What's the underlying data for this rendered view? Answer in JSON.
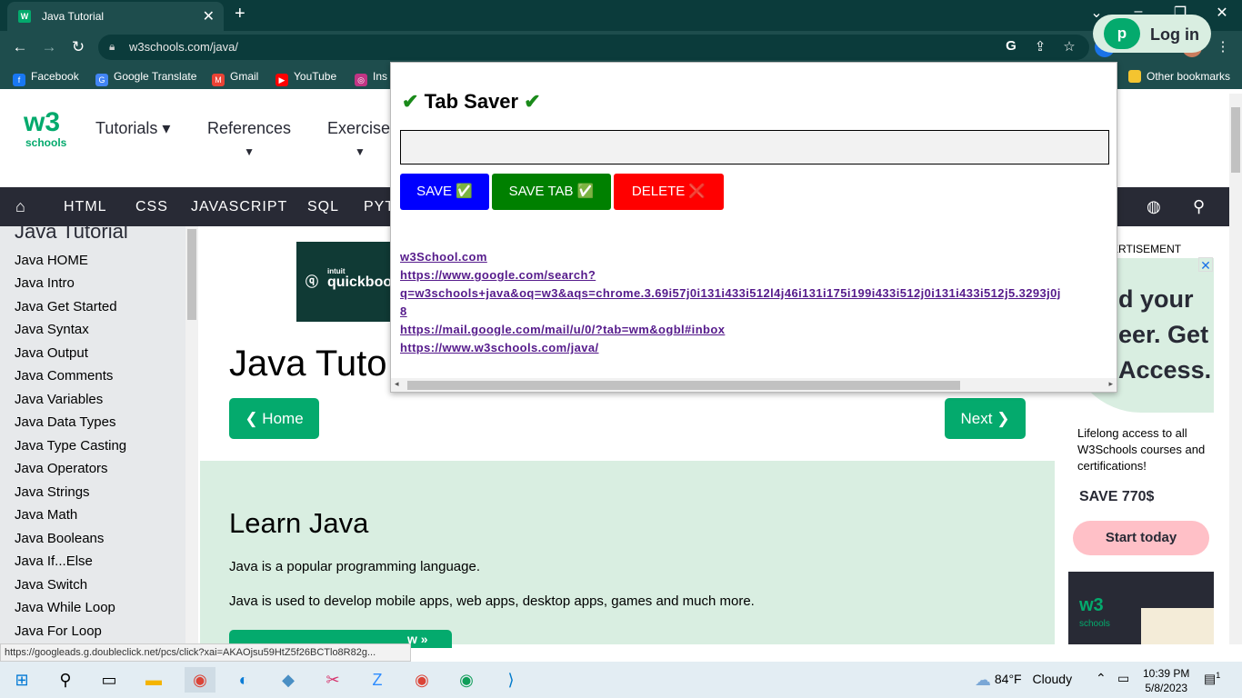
{
  "browser": {
    "tab_title": "Java Tutorial",
    "favicon_text": "W",
    "url": "w3schools.com/java/",
    "bookmarks": [
      {
        "label": "Facebook",
        "color": "#1877f2"
      },
      {
        "label": "Google Translate",
        "color": "#4285f4"
      },
      {
        "label": "Gmail",
        "color": "#ea4335"
      },
      {
        "label": "YouTube",
        "color": "#ff0000"
      },
      {
        "label": "Ins",
        "color": "#c13584"
      }
    ],
    "other_bookmarks": "Other bookmarks"
  },
  "header": {
    "logo_text": "w3",
    "logo_sub": "schools",
    "menu": [
      "Tutorials ▾",
      "References",
      "Exercises"
    ],
    "signup_partial": "p",
    "login_label": "Log in"
  },
  "topnav": {
    "items": [
      "HTML",
      "CSS",
      "JAVASCRIPT",
      "SQL",
      "PYT"
    ]
  },
  "sidebar": {
    "heading": "Java Tutorial",
    "items": [
      "Java HOME",
      "Java Intro",
      "Java Get Started",
      "Java Syntax",
      "Java Output",
      "Java Comments",
      "Java Variables",
      "Java Data Types",
      "Java Type Casting",
      "Java Operators",
      "Java Strings",
      "Java Math",
      "Java Booleans",
      "Java If...Else",
      "Java Switch",
      "Java While Loop",
      "Java For Loop"
    ]
  },
  "main": {
    "ad_text": "quickbooks",
    "ad_small": "intuit",
    "title": "Java Tuto",
    "home_button": "❮ Home",
    "next_button": "Next ❯",
    "learn_heading": "Learn Java",
    "learn_p1": "Java is a popular programming language.",
    "learn_p2": "Java is used to develop mobile apps, web apps, desktop apps, games and much more.",
    "learn_button_tail": "w »"
  },
  "right_ad": {
    "label": "ERTISEMENT",
    "headline": "d your eer. Get Access.",
    "body": "Lifelong access to all W3Schools courses and certifications!",
    "save": "SAVE 770$",
    "cta": "Start today",
    "logo": "w3",
    "logo_sub": "schools"
  },
  "status_url": "https://googleads.g.doubleclick.net/pcs/click?xai=AKAOjsu59HtZ5f26BCTlo8R82g...",
  "popup": {
    "title": "Tab Saver",
    "input_value": "",
    "buttons": {
      "save": "SAVE ✅",
      "save_tab": "SAVE TAB ✅",
      "delete": "DELETE ❌"
    },
    "links": [
      "w3School.com",
      "https://www.google.com/search?",
      "q=w3schools+java&oq=w3&aqs=chrome.3.69i57j0i131i433i512l4j46i131i175i199i433i512j0i131i433i512j5.3293j0j",
      "8",
      "https://mail.google.com/mail/u/0/?tab=wm&ogbl#inbox",
      "https://www.w3schools.com/java/"
    ]
  },
  "taskbar": {
    "weather_temp": "84°F",
    "weather_text": "Cloudy",
    "time": "10:39 PM",
    "date": "5/8/2023",
    "notif_count": "1"
  }
}
